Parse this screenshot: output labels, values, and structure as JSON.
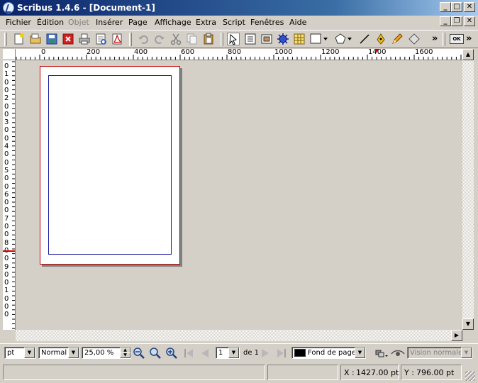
{
  "window": {
    "title": "Scribus 1.4.6 - [Document-1]",
    "min_glyph": "_",
    "max_glyph": "□",
    "close_glyph": "✕",
    "restore_glyph": "❐"
  },
  "menu": {
    "items": [
      {
        "label": "Fichier",
        "enabled": true
      },
      {
        "label": "Édition",
        "enabled": true
      },
      {
        "label": "Objet",
        "enabled": false
      },
      {
        "label": "Insérer",
        "enabled": true
      },
      {
        "label": "Page",
        "enabled": true
      },
      {
        "label": "Affichage",
        "enabled": true
      },
      {
        "label": "Extra",
        "enabled": true
      },
      {
        "label": "Script",
        "enabled": true
      },
      {
        "label": "Fenêtres",
        "enabled": true
      },
      {
        "label": "Aide",
        "enabled": true
      }
    ]
  },
  "toolbar": {
    "overflow_glyph": "»",
    "ok_label": "OK"
  },
  "rulers": {
    "horizontal": [
      "0",
      "200",
      "400",
      "600",
      "800",
      "1000",
      "1200",
      "1400",
      "1600"
    ],
    "vertical": [
      "0",
      "1",
      "0",
      "0",
      "2",
      "0",
      "0",
      "3",
      "0",
      "0",
      "4",
      "0",
      "0",
      "5",
      "0",
      "0",
      "6",
      "0",
      "0",
      "7",
      "0",
      "0",
      "8",
      "0",
      "0",
      "9",
      "0",
      "0",
      "1",
      "0",
      "0",
      "0"
    ]
  },
  "bottom": {
    "unit": "pt",
    "mode": "Normal",
    "zoom": "25,00 %",
    "page_number": "1",
    "page_of": "de 1",
    "layer": "Fond de page",
    "layer_color": "#000000",
    "preview_mode": "Vision normale"
  },
  "status": {
    "message": "",
    "x_label": "X :",
    "x_value": "1427.00 pt",
    "y_label": "Y :",
    "y_value": "796.00 pt"
  },
  "colors": {
    "page_border": "#c00000",
    "margin_guide": "#1e1ea0",
    "title_start": "#0a246a",
    "title_end": "#a6caf0"
  }
}
